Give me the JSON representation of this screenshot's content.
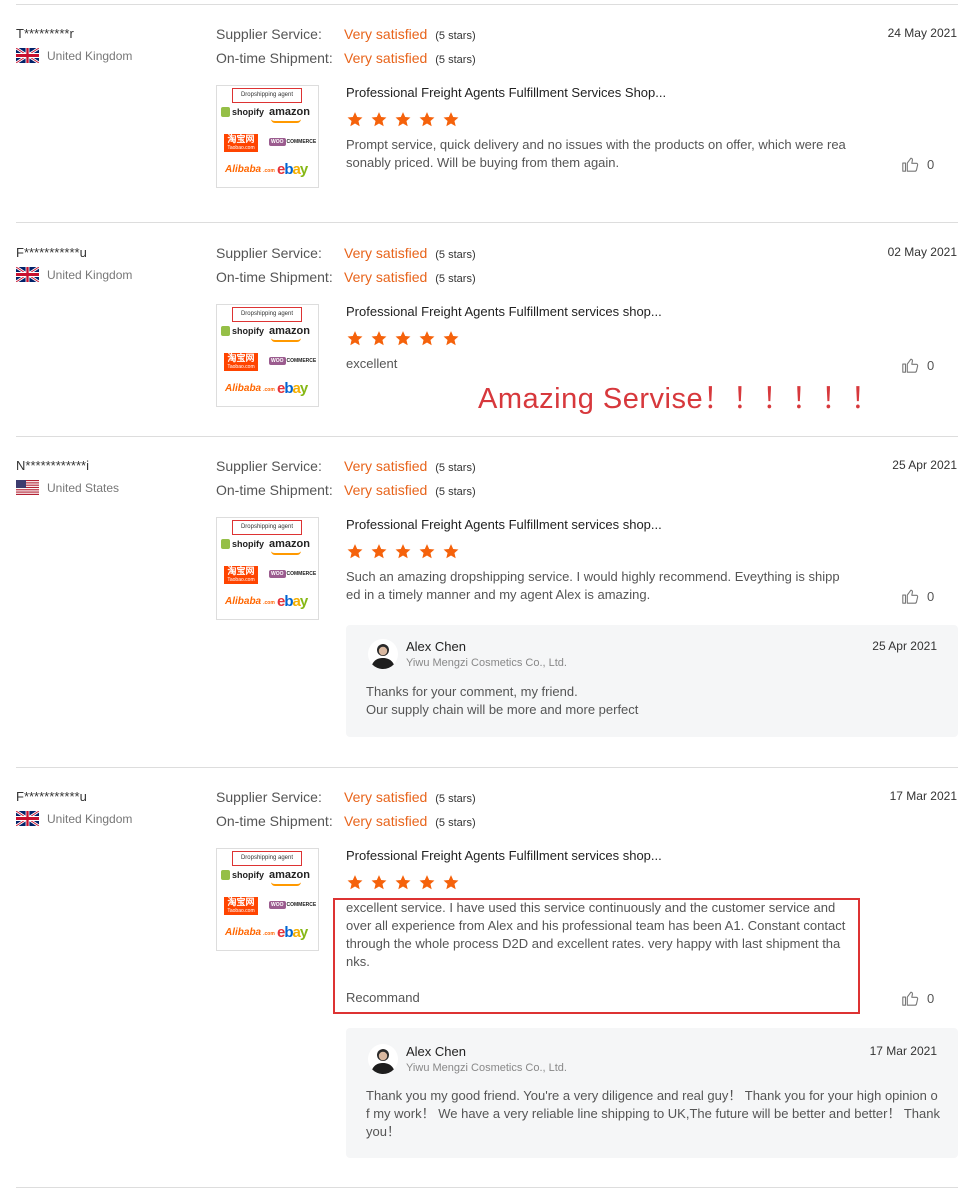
{
  "colors": {
    "accent": "#e8641b",
    "star": "#f5620b",
    "highlight": "#d33"
  },
  "rating_labels": {
    "supplier": "Supplier Service:",
    "shipment": "On-time Shipment:"
  },
  "thumb": {
    "tag": "Dropshipping agent",
    "shopify": "shopify",
    "amazon": "amazon",
    "taobao": "淘宝网",
    "taobao_sub": "Taobao.com",
    "woo": "COMMERCE",
    "woo_badge": "WOO",
    "alibaba": "Alibaba",
    "alibaba_sub": ".com",
    "ebay": [
      "e",
      "b",
      "a",
      "y"
    ]
  },
  "reviews": [
    {
      "user": "T*********r",
      "country": "United Kingdom",
      "flag": "uk-flag-icon",
      "supplier_value": "Very satisfied",
      "supplier_stars": "(5 stars)",
      "shipment_value": "Very satisfied",
      "shipment_stars": "(5 stars)",
      "date": "24 May 2021",
      "product": "Professional Freight Agents Fulfillment Services Shop...",
      "rating": 5,
      "text": "Prompt service, quick delivery and no issues with the products on offer, which were reasonably priced. Will be buying from them again.",
      "likes": "0"
    },
    {
      "user": "F***********u",
      "country": "United Kingdom",
      "flag": "uk-flag-icon",
      "supplier_value": "Very satisfied",
      "supplier_stars": "(5 stars)",
      "shipment_value": "Very satisfied",
      "shipment_stars": "(5 stars)",
      "date": "02 May 2021",
      "product": "Professional Freight Agents Fulfillment services shop...",
      "rating": 5,
      "text": "excellent",
      "likes": "0"
    },
    {
      "user": "N************i",
      "country": "United States",
      "flag": "us-flag-icon",
      "supplier_value": "Very satisfied",
      "supplier_stars": "(5 stars)",
      "shipment_value": "Very satisfied",
      "shipment_stars": "(5 stars)",
      "date": "25 Apr 2021",
      "product": "Professional Freight Agents Fulfillment services shop...",
      "rating": 5,
      "text": "Such an amazing dropshipping service. I would highly recommend. Eveything is shipped in a timely manner and my agent Alex is amazing.",
      "likes": "0",
      "reply": {
        "name": "Alex Chen",
        "company": "Yiwu Mengzi Cosmetics Co., Ltd.",
        "date": "25 Apr 2021",
        "lines": [
          "Thanks for your comment, my friend.",
          "Our supply chain will be more and more perfect"
        ]
      }
    },
    {
      "user": "F***********u",
      "country": "United Kingdom",
      "flag": "uk-flag-icon",
      "supplier_value": "Very satisfied",
      "supplier_stars": "(5 stars)",
      "shipment_value": "Very satisfied",
      "shipment_stars": "(5 stars)",
      "date": "17 Mar 2021",
      "product": "Professional Freight Agents Fulfillment services shop...",
      "rating": 5,
      "text": "excellent service. I have used this service continuously and the customer service and over all experience  from Alex and his professional team has been A1. Constant contact through the whole  process D2D and excellent rates. very happy with last shipment thanks.",
      "text_extra": "Recommand",
      "likes": "0",
      "reply": {
        "name": "Alex Chen",
        "company": "Yiwu Mengzi Cosmetics Co., Ltd.",
        "date": "17 Mar 2021",
        "lines": [
          "Thank you my good friend. You're a very diligence and real guy！ Thank you for your high opinion of my work！ We have a very reliable line shipping to UK,The future will be better and better！ Thank you！"
        ]
      }
    }
  ],
  "annotation": "Amazing Servise！！！！！！"
}
